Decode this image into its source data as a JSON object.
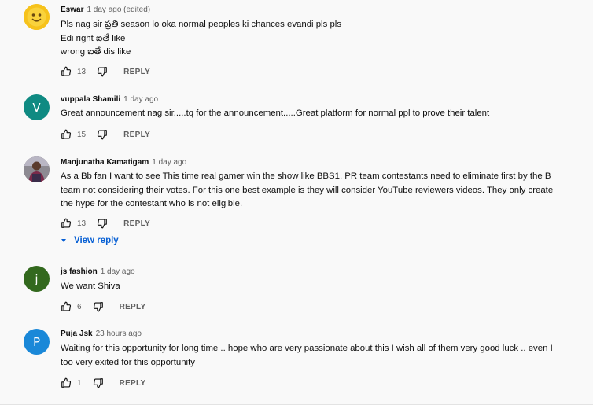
{
  "colors": {
    "avatar_v": "#0f8a82",
    "avatar_j": "#33691e",
    "avatar_p": "#1a88d8",
    "link": "#065fd4"
  },
  "comments": [
    {
      "author": "Eswar",
      "time": "1 day ago (edited)",
      "avatar_letter": "",
      "avatar_icon": "emoji-face-icon",
      "lines": [
        "Pls nag sir ప్రతి season lo  oka normal peoples ki chances evandi pls pls",
        "Edi right ఐతే like",
        "wrong ఐతే  dis like"
      ],
      "likes": "13",
      "reply_label": "REPLY"
    },
    {
      "author": "vuppala Shamili",
      "time": "1 day ago",
      "avatar_letter": "V",
      "lines": [
        "Great announcement nag sir.....tq for the announcement.....Great platform for normal ppl to prove their talent"
      ],
      "likes": "15",
      "reply_label": "REPLY"
    },
    {
      "author": "Manjunatha Kamatigam",
      "time": "1 day ago",
      "avatar_letter": "",
      "avatar_icon": "person-photo-icon",
      "lines": [
        "As a Bb fan I want to see This time real gamer win the show like BBS1. PR team contestants need to eliminate first by the B",
        "team not considering their votes. For this one best example is they will consider YouTube reviewers videos. They only create",
        "the hype for the contestant who is not eligible."
      ],
      "likes": "13",
      "reply_label": "REPLY",
      "view_reply_label": "View reply"
    },
    {
      "author": "js fashion",
      "time": "1 day ago",
      "avatar_letter": "j",
      "lines": [
        "We want Shiva"
      ],
      "likes": "6",
      "reply_label": "REPLY"
    },
    {
      "author": "Puja Jsk",
      "time": "23 hours ago",
      "avatar_letter": "P",
      "lines": [
        "Waiting for this opportunity for long time .. hope  who are very passionate about this  I wish all of them very good luck .. even I",
        "too very exited for this opportunity"
      ],
      "likes": "1",
      "reply_label": "REPLY"
    }
  ]
}
